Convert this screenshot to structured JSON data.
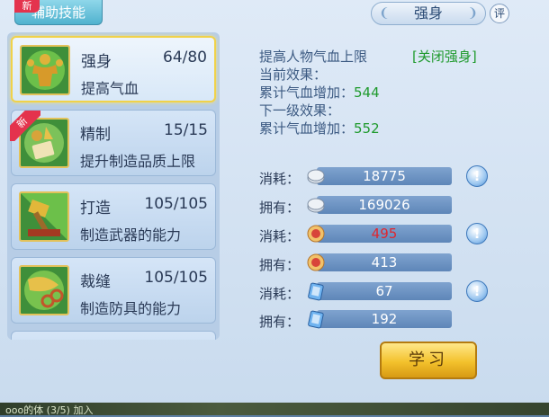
{
  "tab": {
    "label": "辅助技能",
    "badge": "新"
  },
  "skills": [
    {
      "name": "强身",
      "level": "64/80",
      "desc": "提高气血",
      "selected": true,
      "new": false
    },
    {
      "name": "精制",
      "level": "15/15",
      "desc": "提升制造品质上限",
      "selected": false,
      "new": true
    },
    {
      "name": "打造",
      "level": "105/105",
      "desc": "制造武器的能力",
      "selected": false,
      "new": false
    },
    {
      "name": "裁缝",
      "level": "105/105",
      "desc": "制造防具的能力",
      "selected": false,
      "new": false
    }
  ],
  "new_badge": "新",
  "title": "强身",
  "rate_label": "评",
  "detail": {
    "effect_desc": "提高人物气血上限",
    "toggle_label": "[关闭强身]",
    "current_label": "当前效果：",
    "current_line": "累计气血增加：",
    "current_value": "544",
    "next_label": "下一级效果：",
    "next_line": "累计气血增加：",
    "next_value": "552"
  },
  "resources": [
    {
      "label": "消耗：",
      "icon": "silver-coin-icon",
      "value": "18775",
      "hint": true,
      "red": false
    },
    {
      "label": "拥有：",
      "icon": "silver-coin-icon",
      "value": "169026",
      "hint": false,
      "red": false
    },
    {
      "label": "消耗：",
      "icon": "contribution-icon",
      "value": "495",
      "hint": true,
      "red": true
    },
    {
      "label": "拥有：",
      "icon": "contribution-icon",
      "value": "413",
      "hint": false,
      "red": false
    },
    {
      "label": "消耗：",
      "icon": "vitality-card-icon",
      "value": "67",
      "hint": true,
      "red": false
    },
    {
      "label": "拥有：",
      "icon": "vitality-card-icon",
      "value": "192",
      "hint": false,
      "red": false
    }
  ],
  "hint_glyph": "!",
  "learn_button": "学习",
  "bottom_text": "ooo的体 (3/5) 加入"
}
